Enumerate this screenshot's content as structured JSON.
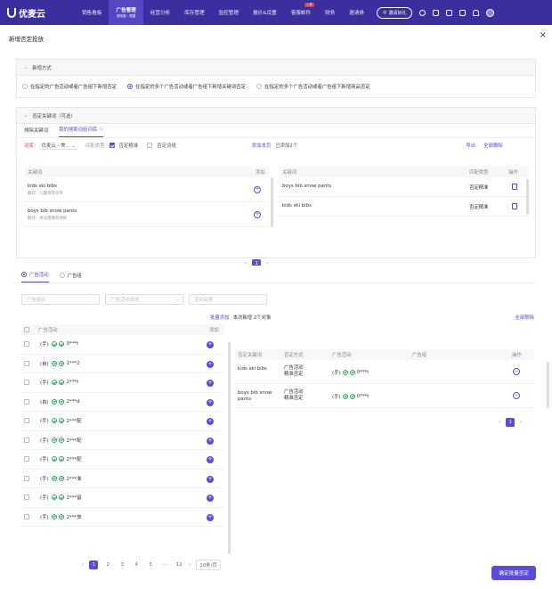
{
  "app": {
    "name": "优麦云"
  },
  "nav": {
    "items": [
      {
        "label": "销售看板",
        "sub": ""
      },
      {
        "label": "广告管理",
        "sub": "亚马逊 · 美国",
        "active": true
      },
      {
        "label": "经营分析",
        "sub": ""
      },
      {
        "label": "库存管理",
        "sub": ""
      },
      {
        "label": "监控管理",
        "sub": ""
      },
      {
        "label": "报价&设置",
        "sub": ""
      },
      {
        "label": "客服邮件",
        "sub": "",
        "badge": "上新"
      },
      {
        "label": "财务",
        "sub": ""
      },
      {
        "label": "邀请券",
        "sub": ""
      }
    ],
    "search_label": "邀请好礼"
  },
  "modal": {
    "title": "新增否定投放",
    "close": "×",
    "mode_section": {
      "title": "新增方式",
      "options": [
        "在指定的广告活动或者广告组下新增否定",
        "在指定的多个广告活动或者广告组下新增关键词否定",
        "在指定的多个广告活动或者广告组下新增商品否定"
      ],
      "selected": 1
    },
    "keyword_section": {
      "title": "否定关键词（可选）",
      "tabs": [
        "排除关键词",
        "我的搜索词组词库 ⓘ"
      ],
      "active_tab": 1,
      "filter": {
        "label": "词库:",
        "select": "优麦云 - 美...",
        "match_label": "匹配类型",
        "opt1": "否定精准",
        "opt2": "否定词组"
      },
      "add_this_page": "添加本页",
      "added_count": "已添加2个",
      "export": "导出",
      "delete_all": "全部删除",
      "left_headers": {
        "keyword": "关键词",
        "add": "添加"
      },
      "left_rows": [
        {
          "keyword": "kids ski bibs",
          "translation": "翻译：儿童滑雪背带"
        },
        {
          "keyword": "boys bib snow pants",
          "translation": "翻译：男孩围嘴雪地裤"
        }
      ],
      "right_headers": {
        "keyword": "关键词",
        "match": "匹配类型",
        "action": "操作"
      },
      "right_rows": [
        {
          "keyword": "boys bib snow pants",
          "match": "否定精准"
        },
        {
          "keyword": "kids ski bibs",
          "match": "否定精准"
        }
      ],
      "pager": {
        "prev": "‹",
        "page": "1",
        "next": "›"
      }
    },
    "campaign_section": {
      "tabs": [
        "广告活动",
        "广告组"
      ],
      "active_tab": 0,
      "filters": [
        "广告组合",
        "广告活动状态",
        "活动名称"
      ],
      "bulk_add": "批量添加",
      "new_count": "本次新增 2个对象",
      "delete_all": "全部删除",
      "left_headers": {
        "campaign": "广告活动",
        "add": "添加"
      },
      "left_rows": [
        {
          "type": "(手)",
          "name": "0***t"
        },
        {
          "type": "(自)",
          "name": "1***2"
        },
        {
          "type": "(手)",
          "name": "2***t"
        },
        {
          "type": "(自)",
          "name": "2***d"
        },
        {
          "type": "(手)",
          "name": "2***配"
        },
        {
          "type": "(手)",
          "name": "2***配"
        },
        {
          "type": "(手)",
          "name": "2***配"
        },
        {
          "type": "(手)",
          "name": "2***准"
        },
        {
          "type": "(手)",
          "name": "2***留"
        },
        {
          "type": "(手)",
          "name": "2***放"
        }
      ],
      "right_headers": {
        "keyword": "否定关键词",
        "method": "否定方式",
        "campaign": "广告活动",
        "group": "广告组",
        "action": "操作"
      },
      "right_rows": [
        {
          "keyword": "kids ski bibs",
          "method": "广告活动\n精准否定",
          "type": "(手)",
          "name": "0***t"
        },
        {
          "keyword": "boys bib snow pants",
          "method": "广告活动\n精准否定",
          "type": "(手)",
          "name": "0***t"
        }
      ],
      "pager": {
        "prev": "‹",
        "pages": [
          "1",
          "2",
          "3",
          "4",
          "5",
          "···",
          "12"
        ],
        "next": "›",
        "size": "10条/页"
      },
      "right_pager": {
        "prev": "‹",
        "page": "1",
        "next": "›"
      }
    },
    "confirm": "确定批量否定"
  }
}
